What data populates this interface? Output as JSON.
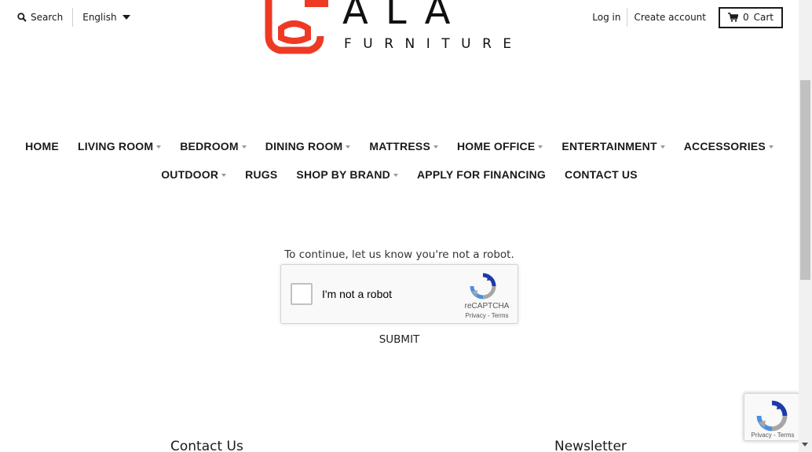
{
  "header": {
    "search_label": "Search",
    "language": "English",
    "login_label": "Log in",
    "create_account_label": "Create account",
    "cart_count": "0",
    "cart_label": "Cart"
  },
  "logo": {
    "word": "ALA",
    "sub": "FURNITURE",
    "brand_color": "#ee3a24"
  },
  "nav": {
    "row1": [
      {
        "label": "HOME",
        "dropdown": false
      },
      {
        "label": "LIVING ROOM",
        "dropdown": true
      },
      {
        "label": "BEDROOM",
        "dropdown": true
      },
      {
        "label": "DINING ROOM",
        "dropdown": true
      },
      {
        "label": "MATTRESS",
        "dropdown": true
      },
      {
        "label": "HOME OFFICE",
        "dropdown": true
      },
      {
        "label": "ENTERTAINMENT",
        "dropdown": true
      },
      {
        "label": "ACCESSORIES",
        "dropdown": true
      }
    ],
    "row2": [
      {
        "label": "OUTDOOR",
        "dropdown": true
      },
      {
        "label": "RUGS",
        "dropdown": false
      },
      {
        "label": "SHOP BY BRAND",
        "dropdown": true
      },
      {
        "label": "APPLY FOR FINANCING",
        "dropdown": false
      },
      {
        "label": "CONTACT US",
        "dropdown": false
      }
    ]
  },
  "captcha": {
    "prompt": "To continue, let us know you're not a robot.",
    "checkbox_label": "I'm not a robot",
    "brand": "reCAPTCHA",
    "privacy": "Privacy",
    "separator": " - ",
    "terms": "Terms",
    "submit_label": "SUBMIT"
  },
  "footer": {
    "contact_heading": "Contact Us",
    "newsletter_heading": "Newsletter"
  },
  "badge": {
    "privacy": "Privacy",
    "separator": " - ",
    "terms": "Terms"
  },
  "colors": {
    "recaptcha_blue": "#1c3aa9",
    "recaptcha_lightblue": "#4a90e2",
    "recaptcha_gray": "#a6a6a6"
  }
}
